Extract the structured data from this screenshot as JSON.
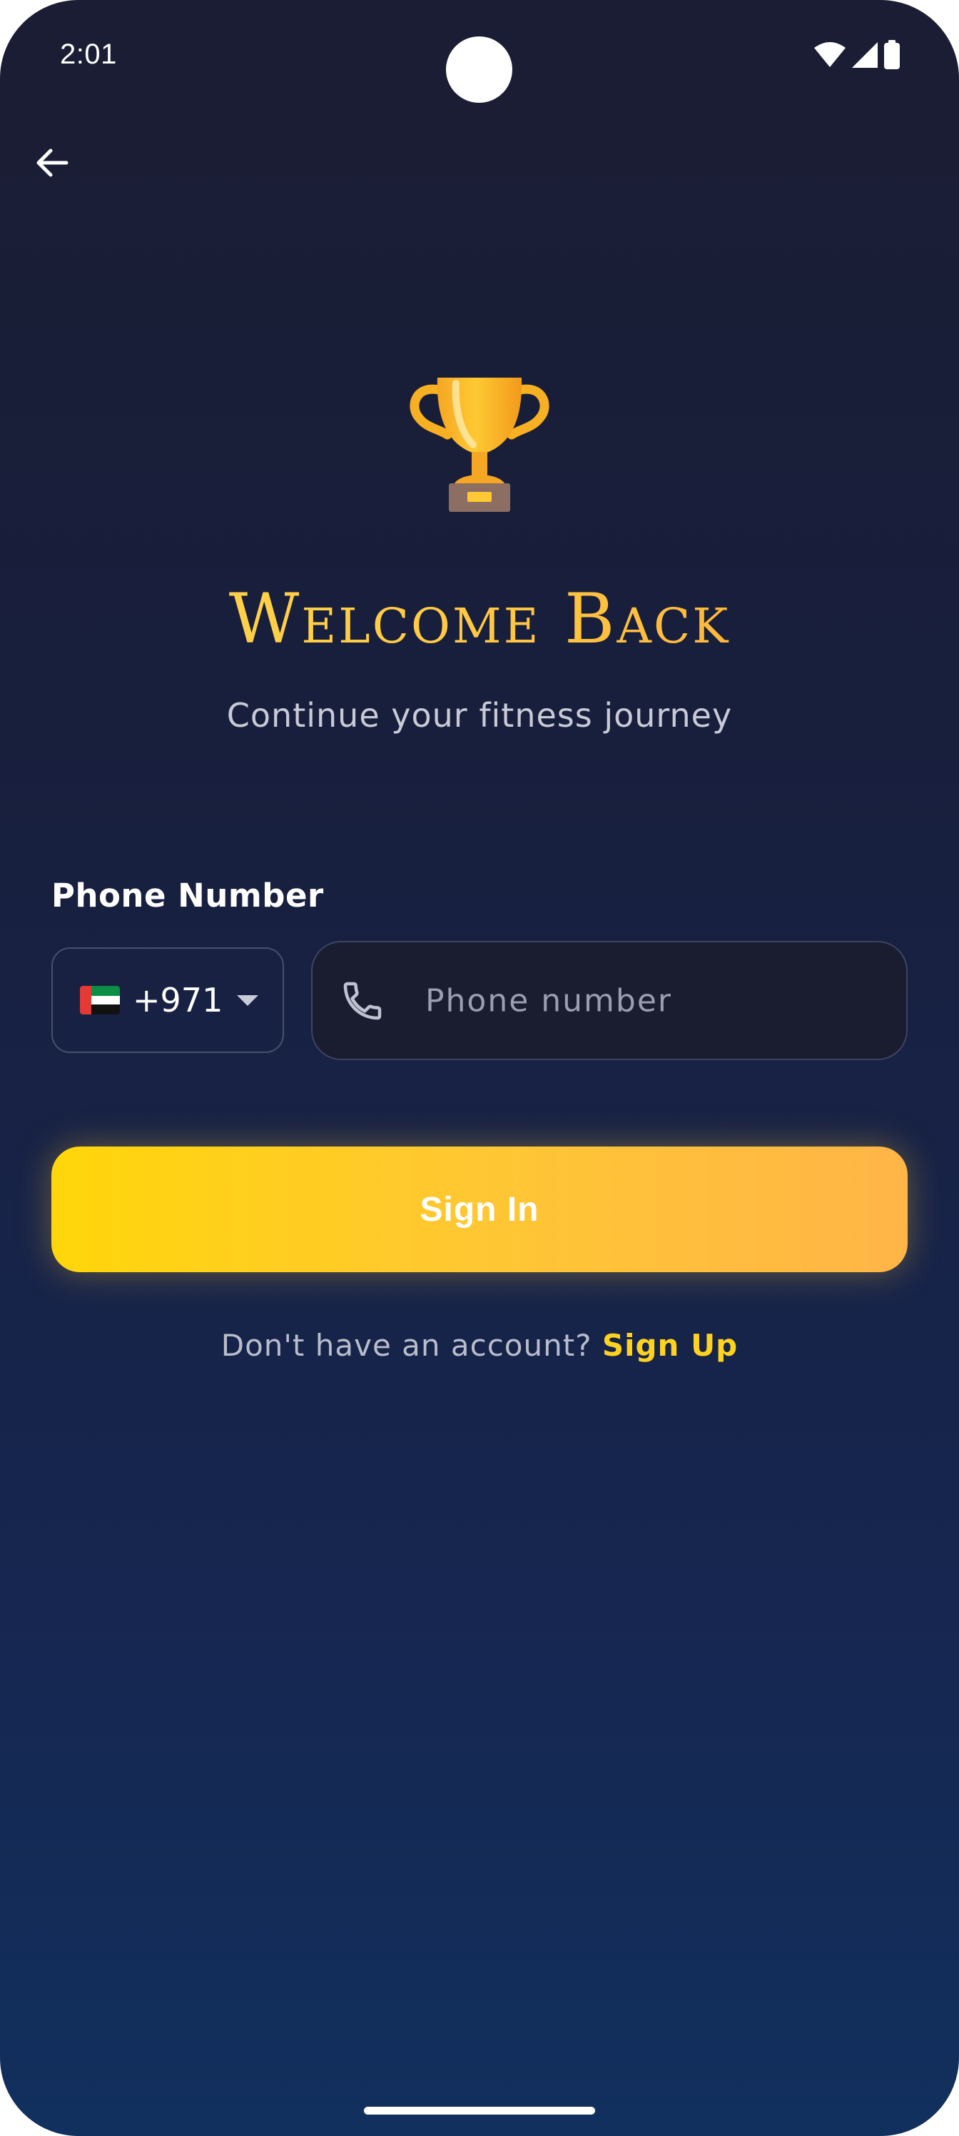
{
  "status_bar": {
    "time": "2:01",
    "icons": [
      "wifi-icon",
      "signal-icon",
      "battery-icon"
    ]
  },
  "header": {
    "back_icon": "arrow-left-icon"
  },
  "hero": {
    "icon": "trophy-icon",
    "title": "Welcome Back",
    "subtitle": "Continue your fitness journey"
  },
  "form": {
    "phone_label": "Phone Number",
    "country": {
      "flag": "uae-flag-icon",
      "code": "+971"
    },
    "phone_icon": "phone-icon",
    "phone_placeholder": "Phone number",
    "phone_value": ""
  },
  "actions": {
    "signin_label": "Sign In",
    "signup_prompt": "Don't have an account?",
    "signup_link": "Sign Up"
  },
  "colors": {
    "accent": "#FFD21F",
    "button_gradient_start": "#FFD60A",
    "button_gradient_end": "#FFB547",
    "background_top": "#1A1D33",
    "background_bottom": "#11305E"
  }
}
